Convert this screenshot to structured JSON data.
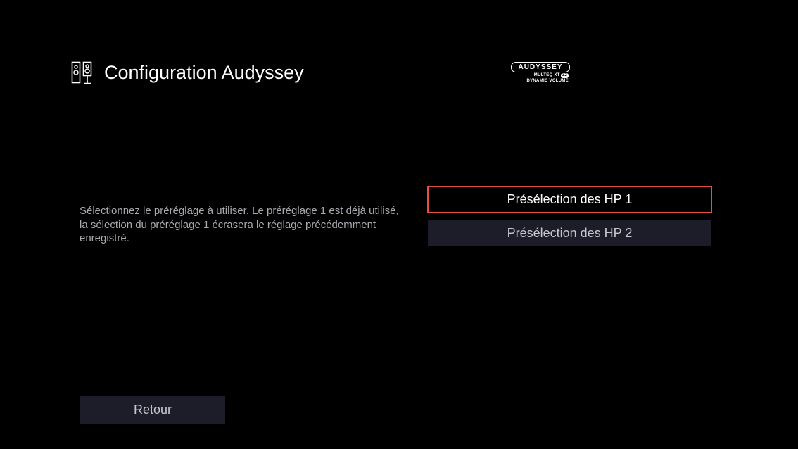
{
  "header": {
    "title": "Configuration Audyssey",
    "icon": "speakers-icon"
  },
  "logo": {
    "brand": "AUDYSSEY",
    "line1": "MULTEQ XT",
    "badge": "32",
    "line2": "DYNAMIC VOLUME"
  },
  "description": "Sélectionnez le préréglage à utiliser. Le préréglage 1 est déjà utilisé, la sélection du préréglage 1 écrasera le réglage précédemment enregistré.",
  "presets": [
    {
      "label": "Présélection des HP 1",
      "selected": true
    },
    {
      "label": "Présélection des HP 2",
      "selected": false
    }
  ],
  "back_button": {
    "label": "Retour"
  },
  "colors": {
    "background": "#000000",
    "button_bg": "#1d1d2a",
    "focus_border": "#e2523e",
    "description_text": "#a9a9b0"
  }
}
